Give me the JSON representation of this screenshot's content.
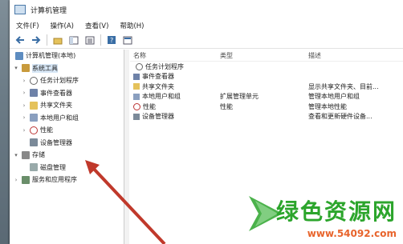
{
  "window": {
    "title": "计算机管理"
  },
  "menu": [
    "文件(F)",
    "操作(A)",
    "查看(V)",
    "帮助(H)"
  ],
  "tree": {
    "root": "计算机管理(本地)",
    "system_tools": "系统工具",
    "items": [
      "任务计划程序",
      "事件查看器",
      "共享文件夹",
      "本地用户和组",
      "性能",
      "设备管理器"
    ],
    "storage": "存储",
    "disk_management": "磁盘管理",
    "services": "服务和应用程序"
  },
  "list": {
    "headers": {
      "name": "名称",
      "type": "类型",
      "desc": "描述"
    },
    "rows": [
      {
        "name": "任务计划程序",
        "type": "",
        "desc": ""
      },
      {
        "name": "事件查看器",
        "type": "",
        "desc": ""
      },
      {
        "name": "共享文件夹",
        "type": "",
        "desc": "显示共享文件夹、目前..."
      },
      {
        "name": "本地用户和组",
        "type": "扩展管理单元",
        "desc": "管理本地用户和组"
      },
      {
        "name": "性能",
        "type": "性能",
        "desc": "管理本地性能"
      },
      {
        "name": "设备管理器",
        "type": "",
        "desc": "查看和更新硬件设备..."
      }
    ]
  },
  "watermark": {
    "text": "绿色资源网",
    "url": "www.54092.com"
  },
  "colors": {
    "arrow": "#c0392b",
    "watermark_green": "#2ca52c",
    "watermark_orange": "#e8642c"
  }
}
